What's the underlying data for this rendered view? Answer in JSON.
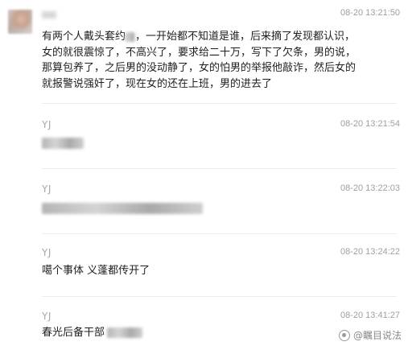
{
  "messages": [
    {
      "sender": "",
      "time": "08-20 13:21:50",
      "text_parts": [
        "有两个人戴头套约",
        "，一开始都不知道是谁，后来摘了发现都认识，女的就很震惊了，不高兴了，要求给二十万，写下了欠条，男的说，那算包养了，之后男的没动静了，女的怕男的举报他敲诈，然后女的就报警说强奸了，现在女的还在上班，男的进去了"
      ]
    },
    {
      "sender": "YJ",
      "time": "08-20 13:21:54",
      "text": ""
    },
    {
      "sender": "YJ",
      "time": "08-20 13:22:03",
      "text": ""
    },
    {
      "sender": "YJ",
      "time": "08-20 13:24:22",
      "text": "噶个事体 义蓬都传开了"
    },
    {
      "sender": "YJ",
      "time": "08-20 13:41:27",
      "text": "春光后备干部"
    }
  ],
  "watermark": {
    "icon": "watermark-logo-icon",
    "text": "@瞩目说法"
  }
}
